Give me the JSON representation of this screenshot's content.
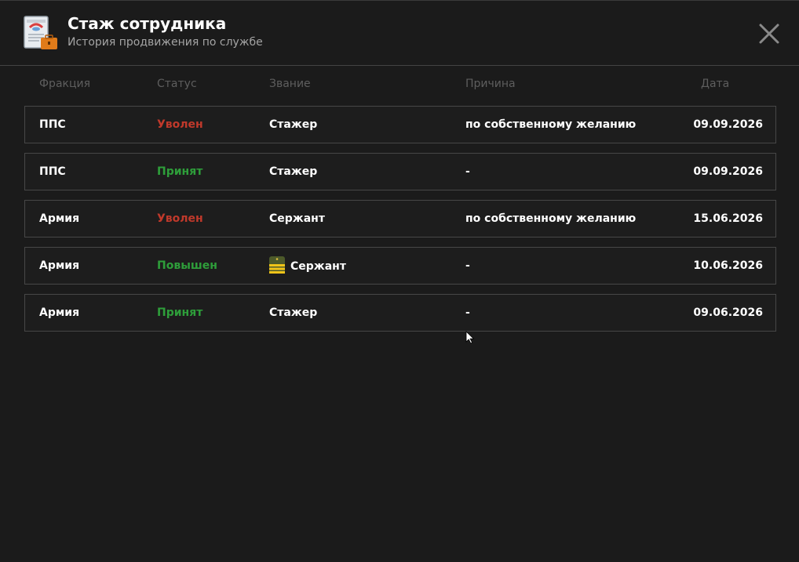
{
  "header": {
    "title": "Стаж сотрудника",
    "subtitle": "История продвижения по службе",
    "app_icon": "certificate-briefcase-icon",
    "close_icon": "close-icon"
  },
  "columns": {
    "faction": "Фракция",
    "status": "Статус",
    "rank": "Звание",
    "reason": "Причина",
    "date": "Дата"
  },
  "colors": {
    "status_fired": "#c0392b",
    "status_positive": "#2e9e3a",
    "background": "#1b1b1b"
  },
  "rows": [
    {
      "faction": "ППС",
      "status": "Уволен",
      "status_type": "fired",
      "rank": "Стажер",
      "rank_icon": false,
      "reason": "по собственному желанию",
      "date": "09.09.2026"
    },
    {
      "faction": "ППС",
      "status": "Принят",
      "status_type": "positive",
      "rank": "Стажер",
      "rank_icon": false,
      "reason": "-",
      "date": "09.09.2026"
    },
    {
      "faction": "Армия",
      "status": "Уволен",
      "status_type": "fired",
      "rank": "Сержант",
      "rank_icon": false,
      "reason": "по собственному желанию",
      "date": "15.06.2026"
    },
    {
      "faction": "Армия",
      "status": "Повышен",
      "status_type": "positive",
      "rank": "Сержант",
      "rank_icon": true,
      "reason": "-",
      "date": "10.06.2026"
    },
    {
      "faction": "Армия",
      "status": "Принят",
      "status_type": "positive",
      "rank": "Стажер",
      "rank_icon": false,
      "reason": "-",
      "date": "09.06.2026"
    }
  ]
}
